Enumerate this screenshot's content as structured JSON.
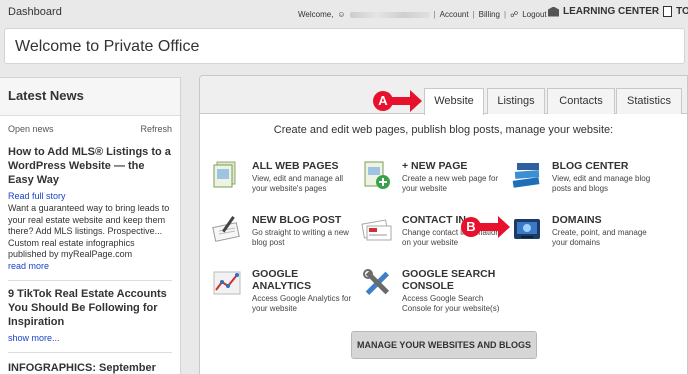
{
  "topbar": {
    "breadcrumb": "Dashboard",
    "welcome_prefix": "Welcome,",
    "account": "Account",
    "billing": "Billing",
    "logout": "Logout",
    "learning_center": "LEARNING CENTER",
    "tour": "TOUR"
  },
  "page_title": "Welcome to Private Office",
  "news": {
    "heading": "Latest News",
    "open_news": "Open news",
    "refresh": "Refresh",
    "article1_title": "How to Add MLS® Listings to a WordPress Website — the Easy Way",
    "article1_link": "Read full story",
    "article1_excerpt": "Want a guaranteed way to bring leads to your real estate website and keep them there? Add MLS listings. Prospective... Custom real estate infographics published by myRealPage.com",
    "article1_more": "read more",
    "article2_title": "9 TikTok Real Estate Accounts You Should Be Following for Inspiration",
    "article2_more": "show more...",
    "article3_title": "INFOGRAPHICS: September"
  },
  "tabs": [
    "Website",
    "Listings",
    "Contacts",
    "Statistics"
  ],
  "tagline": "Create and edit web pages, publish blog posts, manage your website:",
  "items": [
    {
      "title": "ALL WEB PAGES",
      "desc": "View, edit and manage all your website's pages",
      "icon": "pages-icon"
    },
    {
      "title": "+ NEW PAGE",
      "desc": "Create a new web page for your website",
      "icon": "new-page-icon"
    },
    {
      "title": "BLOG CENTER",
      "desc": "View, edit and manage blog posts and blogs",
      "icon": "books-icon"
    },
    {
      "title": "NEW BLOG POST",
      "desc": "Go straight to writing a new blog post",
      "icon": "pen-notebook-icon"
    },
    {
      "title": "CONTACT IN",
      "desc": "Change contact information on your website",
      "icon": "business-card-icon"
    },
    {
      "title": "DOMAINS",
      "desc": "Create, point, and manage your domains",
      "icon": "domains-icon"
    },
    {
      "title": "GOOGLE ANALYTICS",
      "desc": "Access Google Analytics for your website",
      "icon": "analytics-chart-icon"
    },
    {
      "title": "GOOGLE SEARCH CONSOLE",
      "desc": "Access Google Search Console for your website(s)",
      "icon": "tools-icon"
    }
  ],
  "manage_button": "MANAGE YOUR WEBSITES AND BLOGS",
  "markers": {
    "a": "A",
    "b": "B"
  },
  "colors": {
    "marker": "#e8112d",
    "link": "#1a43c8"
  }
}
